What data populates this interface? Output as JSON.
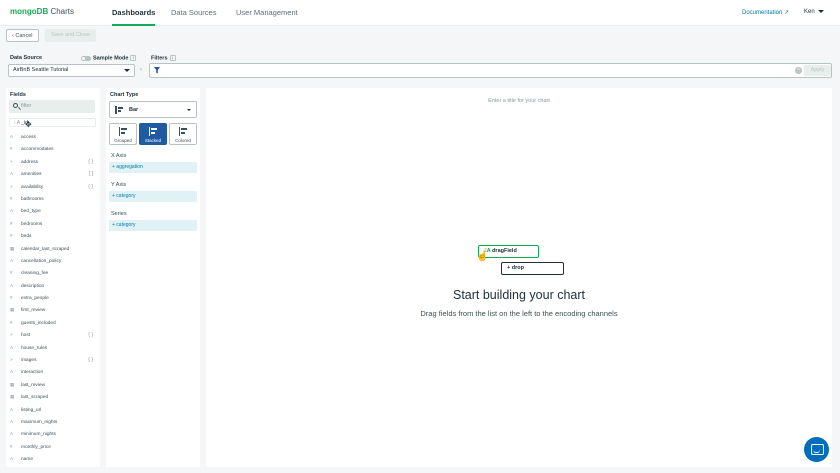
{
  "nav": {
    "logo_brand": "mongoDB",
    "logo_product": "Charts",
    "tabs": [
      {
        "label": "Dashboards",
        "active": true
      },
      {
        "label": "Data Sources",
        "active": false
      },
      {
        "label": "User Management",
        "active": false
      }
    ],
    "documentation": "Documentation",
    "user": "Ken"
  },
  "actions": {
    "cancel": "Cancel",
    "save": "Save and Close"
  },
  "datasource": {
    "label": "Data Source",
    "sample_mode": "Sample Mode",
    "selected": "AirBnB Seattle Tutorial"
  },
  "filters": {
    "label": "Filters",
    "apply": "Apply"
  },
  "fields": {
    "title": "Fields",
    "search_placeholder": "filter",
    "dragging": "_id",
    "items": [
      {
        "icon": "A",
        "name": "access"
      },
      {
        "icon": "#",
        "name": "accommodates"
      },
      {
        "icon": ">",
        "name": "address",
        "bracket": "{ }"
      },
      {
        "icon": "A",
        "name": "amenities",
        "bracket": "[ ]"
      },
      {
        "icon": ">",
        "name": "availability",
        "bracket": "{ }"
      },
      {
        "icon": "#",
        "name": "bathrooms"
      },
      {
        "icon": "A",
        "name": "bed_type"
      },
      {
        "icon": "#",
        "name": "bedrooms"
      },
      {
        "icon": "#",
        "name": "beds"
      },
      {
        "icon": "▦",
        "name": "calendar_last_scraped"
      },
      {
        "icon": "A",
        "name": "cancellation_policy"
      },
      {
        "icon": "#",
        "name": "cleaning_fee"
      },
      {
        "icon": "A",
        "name": "description"
      },
      {
        "icon": "#",
        "name": "extra_people"
      },
      {
        "icon": "▦",
        "name": "first_review"
      },
      {
        "icon": "#",
        "name": "guests_included"
      },
      {
        "icon": ">",
        "name": "host",
        "bracket": "{ }"
      },
      {
        "icon": "A",
        "name": "house_rules"
      },
      {
        "icon": ">",
        "name": "images",
        "bracket": "{ }"
      },
      {
        "icon": "A",
        "name": "interaction"
      },
      {
        "icon": "▦",
        "name": "last_review"
      },
      {
        "icon": "▦",
        "name": "last_scraped"
      },
      {
        "icon": "A",
        "name": "listing_url"
      },
      {
        "icon": "A",
        "name": "maximum_nights"
      },
      {
        "icon": "A",
        "name": "minimum_nights"
      },
      {
        "icon": "#",
        "name": "monthly_price"
      },
      {
        "icon": "A",
        "name": "name"
      }
    ]
  },
  "chart_type": {
    "title": "Chart Type",
    "selected": "Bar",
    "variants": [
      {
        "label": "Grouped",
        "active": false
      },
      {
        "label": "Stacked",
        "active": true
      },
      {
        "label": "Colored",
        "active": false
      }
    ],
    "encodings": [
      {
        "label": "X Axis",
        "drop": "+ aggregation"
      },
      {
        "label": "Y Axis",
        "drop": "+ category"
      },
      {
        "label": "Series",
        "drop": "+ category"
      }
    ]
  },
  "canvas": {
    "title_hint": "Enter a title for your chart",
    "drag_pill": "dragField",
    "drop_pill": "+ drop",
    "heading": "Start building your chart",
    "subheading": "Drag fields from the list on the left to the encoding channels"
  },
  "colors": {
    "brand_green": "#13aa52",
    "accent_blue": "#1f5aa3",
    "chat_blue": "#006cbc"
  }
}
